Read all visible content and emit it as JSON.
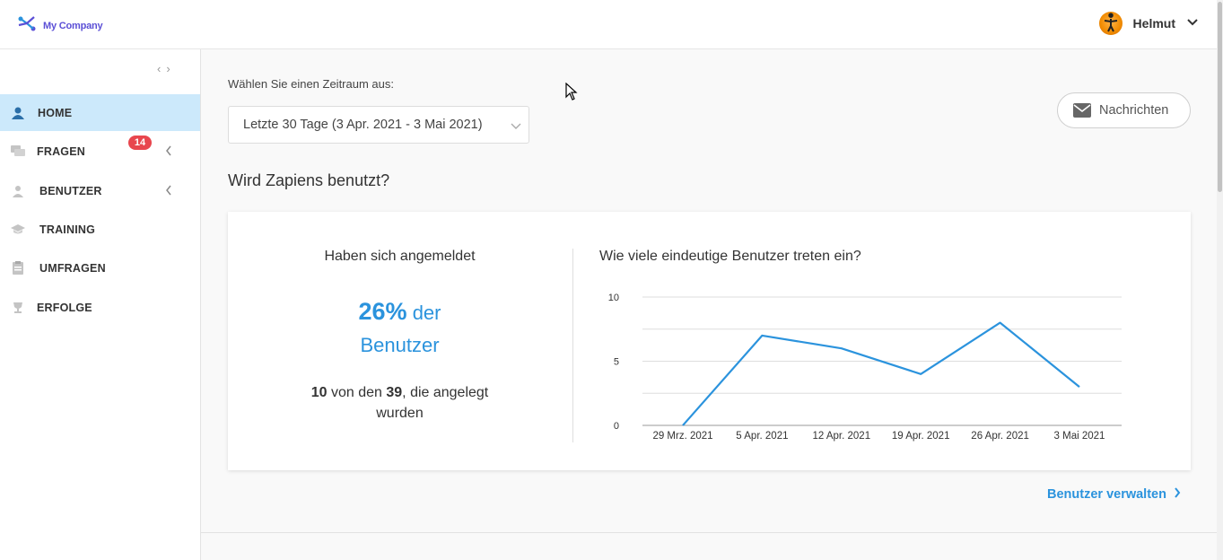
{
  "header": {
    "brand": "My Company",
    "user_name": "Helmut"
  },
  "sidebar": {
    "items": [
      {
        "label": "HOME",
        "icon": "home-user-icon",
        "active": true
      },
      {
        "label": "FRAGEN",
        "icon": "questions-icon",
        "badge": "14",
        "expandable": true
      },
      {
        "label": "BENUTZER",
        "icon": "user-icon",
        "expandable": true
      },
      {
        "label": "TRAINING",
        "icon": "graduation-cap-icon"
      },
      {
        "label": "UMFRAGEN",
        "icon": "clipboard-icon"
      },
      {
        "label": "ERFOLGE",
        "icon": "trophy-icon"
      }
    ]
  },
  "main": {
    "period_label": "Wählen Sie einen Zeitraum aus:",
    "period_selected": "Letzte 30 Tage (3 Apr. 2021 - 3 Mai 2021)",
    "messages_button": "Nachrichten",
    "section_title": "Wird Zapiens benutzt?",
    "card": {
      "left_title": "Haben sich angemeldet",
      "percent": "26%",
      "percent_suffix": "der",
      "percent_line2": "Benutzer",
      "count_active": "10",
      "count_text_1": "von den",
      "count_total": "39",
      "count_text_2": ", die angelegt wurden",
      "chart_title": "Wie viele eindeutige Benutzer treten ein?"
    },
    "manage_link": "Benutzer verwalten"
  },
  "colors": {
    "accent": "#2b93dd",
    "active_nav": "#cce9fb",
    "badge": "#e8464e"
  },
  "chart_data": {
    "type": "line",
    "title": "Wie viele eindeutige Benutzer treten ein?",
    "x": [
      "29 Mrz. 2021",
      "5 Apr. 2021",
      "12 Apr. 2021",
      "19 Apr. 2021",
      "26 Apr. 2021",
      "3 Mai 2021"
    ],
    "series": [
      {
        "points": [
          {
            "x": "29 Mrz. 2021",
            "y": 0
          },
          {
            "x": "5 Apr. 2021",
            "y": 7
          },
          {
            "x": "12 Apr. 2021",
            "y": 6
          },
          {
            "x": "19 Apr. 2021",
            "y": 4
          },
          {
            "x": "26 Apr. 2021",
            "y": 8
          },
          {
            "x": "3 Mai 2021",
            "y": 3
          }
        ],
        "color": "#2b93dd"
      }
    ],
    "yticks": [
      0,
      5,
      10
    ],
    "ylim": [
      0,
      10
    ],
    "grid": true
  }
}
